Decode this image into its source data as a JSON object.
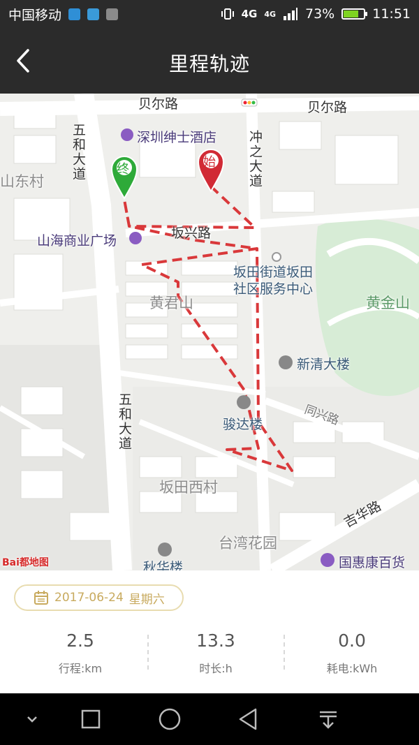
{
  "status_bar": {
    "carrier": "中国移动",
    "network_1": "4G",
    "network_2": "4G",
    "battery_percent": "73%",
    "battery_level": 0.73,
    "time": "11:51"
  },
  "header": {
    "title": "里程轨迹"
  },
  "map": {
    "labels": {
      "road_beier_1": "贝尔路",
      "road_beier_2": "贝尔路",
      "hotel": "深圳绅士酒店",
      "road_wuhe_1": "五和大道",
      "road_chongzhi": "冲之大道",
      "village_shandong": "山东村",
      "mall": "山海商业广场",
      "road_banxing": "坂兴路",
      "service_center": "坂田街道坂田\n社区服务中心",
      "area_huangjunshan": "黄君山",
      "area_huangjinshan": "黄金山",
      "building_xinqing": "新清大楼",
      "building_junda": "骏达楼",
      "road_tongxing": "同兴路",
      "road_wuhe_2": "五和大道",
      "village_bantian_west": "坂田西村",
      "road_jihua": "吉华路",
      "area_taiwan_garden": "台湾花园",
      "building_qiuhua": "秋华楼",
      "store_guohuikang": "国惠康百货",
      "baidu_logo": "Bai都地图"
    },
    "markers": {
      "start": "始",
      "end": "终"
    },
    "colors": {
      "route": "#d9383a",
      "start_marker": "#d12a35",
      "end_marker": "#2eaa39"
    }
  },
  "trip": {
    "date": "2017-06-24",
    "weekday": "星期六",
    "stats": [
      {
        "value": "2.5",
        "label": "行程:km"
      },
      {
        "value": "13.3",
        "label": "时长:h"
      },
      {
        "value": "0.0",
        "label": "耗电:kWh"
      }
    ]
  },
  "nav": {
    "icons": [
      "chevron-down-icon",
      "square-icon",
      "circle-icon",
      "triangle-back-icon",
      "download-icon"
    ]
  }
}
